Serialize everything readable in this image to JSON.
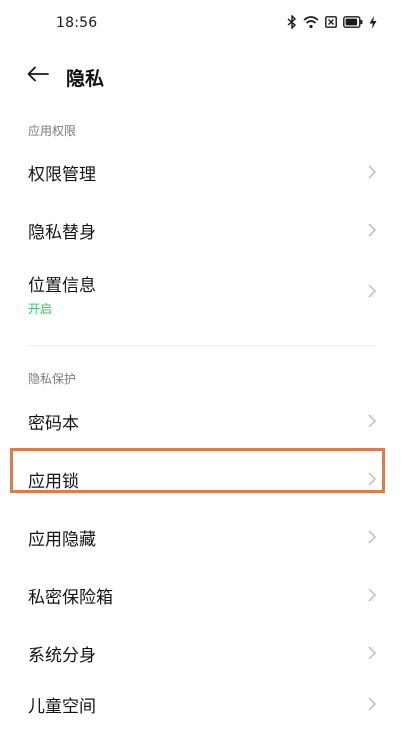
{
  "status_bar": {
    "time": "18:56",
    "icons": [
      "bluetooth-icon",
      "wifi-icon",
      "sim-icon",
      "battery-icon",
      "charging-icon"
    ]
  },
  "header": {
    "back_icon": "arrow-left-icon",
    "title": "隐私"
  },
  "sections": [
    {
      "label": "应用权限",
      "items": [
        {
          "label": "权限管理"
        },
        {
          "label": "隐私替身"
        },
        {
          "label": "位置信息",
          "sub": "开启"
        }
      ]
    },
    {
      "label": "隐私保护",
      "items": [
        {
          "label": "密码本"
        },
        {
          "label": "应用锁"
        },
        {
          "label": "应用隐藏"
        },
        {
          "label": "私密保险箱"
        },
        {
          "label": "系统分身"
        },
        {
          "label": "儿童空间"
        }
      ]
    }
  ],
  "colors": {
    "accent_green": "#2cc76a",
    "highlight_border": "#e07b45"
  }
}
